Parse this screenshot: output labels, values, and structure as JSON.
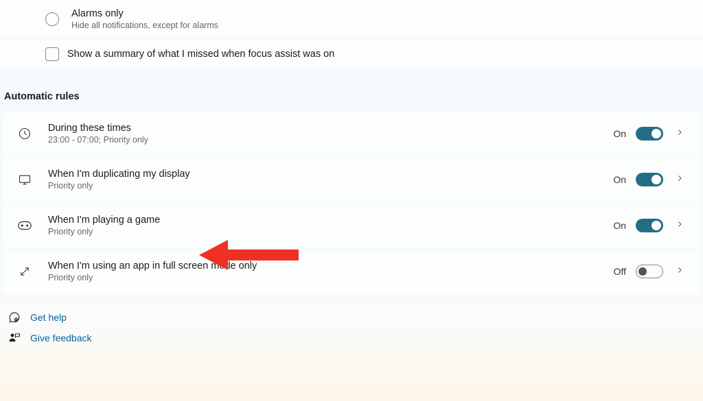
{
  "options": {
    "alarms": {
      "title": "Alarms only",
      "desc": "Hide all notifications, except for alarms"
    },
    "summary": {
      "label": "Show a summary of what I missed when focus assist was on"
    }
  },
  "section_header": "Automatic rules",
  "rules": [
    {
      "title": "During these times",
      "sub": "23:00 - 07:00; Priority only",
      "state_label": "On",
      "state": "on"
    },
    {
      "title": "When I'm duplicating my display",
      "sub": "Priority only",
      "state_label": "On",
      "state": "on"
    },
    {
      "title": "When I'm playing a game",
      "sub": "Priority only",
      "state_label": "On",
      "state": "on"
    },
    {
      "title": "When I'm using an app in full screen mode only",
      "sub": "Priority only",
      "state_label": "Off",
      "state": "off"
    }
  ],
  "footer": {
    "help": "Get help",
    "feedback": "Give feedback"
  }
}
